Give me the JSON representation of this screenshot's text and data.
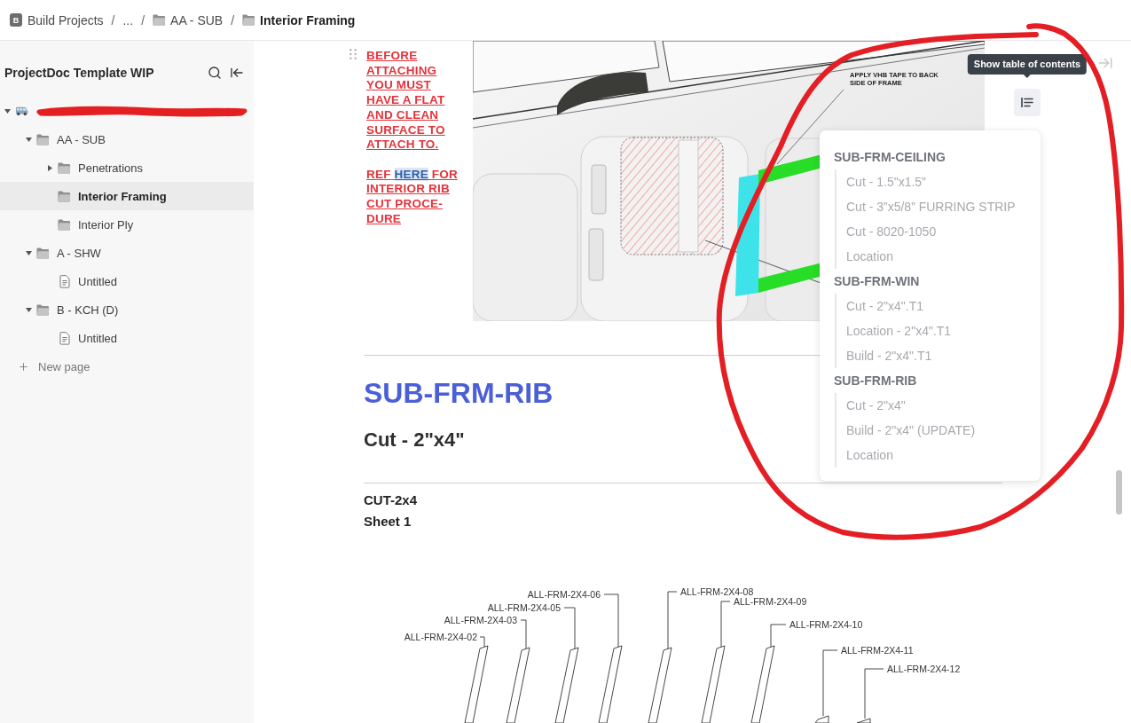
{
  "breadcrumb": {
    "badge": "B",
    "items": [
      {
        "kind": "workspace",
        "label": "Build Projects",
        "current": false
      },
      {
        "kind": "ellipsis",
        "label": "...",
        "separator": "/",
        "current": false
      },
      {
        "kind": "folder",
        "label": "AA - SUB",
        "separator": "/",
        "current": false
      },
      {
        "kind": "folder",
        "label": "Interior Framing",
        "separator": "/",
        "current": true
      }
    ]
  },
  "sidebar": {
    "title": "ProjectDoc Template WIP",
    "tree": [
      {
        "kind": "van",
        "redacted": true,
        "expanded": true,
        "selected": false,
        "children": [
          {
            "kind": "folder",
            "label": "AA - SUB",
            "expanded": true,
            "selected": false,
            "children": [
              {
                "kind": "folder",
                "label": "Penetrations",
                "expanded": false,
                "selected": false
              },
              {
                "kind": "folder",
                "label": "Interior Framing",
                "selected": true
              },
              {
                "kind": "folder",
                "label": "Interior Ply",
                "selected": false
              }
            ]
          },
          {
            "kind": "folder",
            "label": "A - SHW",
            "expanded": true,
            "selected": false,
            "children": [
              {
                "kind": "page",
                "label": "Untitled",
                "selected": false
              }
            ]
          },
          {
            "kind": "folder",
            "label": "B - KCH (D)",
            "expanded": true,
            "selected": false,
            "children": [
              {
                "kind": "page",
                "label": "Untitled",
                "selected": false
              }
            ]
          }
        ]
      }
    ],
    "new_page": "New page"
  },
  "document": {
    "note": {
      "text": "BEFORE\nATTACHING\nYOU MUST\nHAVE A FLAT\nAND CLEAN\nSURFACE TO\nATTACH TO.",
      "ref_before": "REF",
      "ref_link": "HERE",
      "ref_after": "FOR\nINTERIOR RIB\nCUT PROCE-\nDURE"
    },
    "image": {
      "callout": "APPLY VHB TAPE TO BACK\nSIDE OF FRAME"
    },
    "heading_1": "SUB-FRM-RIB",
    "heading_2": "Cut - 2\"x4\"",
    "sheet": {
      "title": "CUT-2x4",
      "subtitle": "Sheet 1"
    },
    "drawing": {
      "parts": [
        "ALL-FRM-2X4-02",
        "ALL-FRM-2X4-03",
        "ALL-FRM-2X4-05",
        "ALL-FRM-2X4-06",
        "ALL-FRM-2X4-08",
        "ALL-FRM-2X4-09",
        "ALL-FRM-2X4-10",
        "ALL-FRM-2X4-11",
        "ALL-FRM-2X4-12"
      ]
    }
  },
  "toc": {
    "tooltip": "Show table of contents",
    "sections": [
      {
        "title": "SUB-FRM-CEILING",
        "items": [
          "Cut - 1.5\"x1.5\"",
          "Cut - 3”x5/8” FURRING STRIP",
          "Cut - 8020-1050",
          "Location"
        ]
      },
      {
        "title": "SUB-FRM-WIN",
        "items": [
          "Cut - 2\"x4\".T1",
          "Location - 2\"x4\".T1",
          "Build - 2\"x4\".T1"
        ]
      },
      {
        "title": "SUB-FRM-RIB",
        "items": [
          "Cut - 2\"x4\"",
          "Build - 2\"x4\" (UPDATE)",
          "Location"
        ]
      }
    ]
  }
}
